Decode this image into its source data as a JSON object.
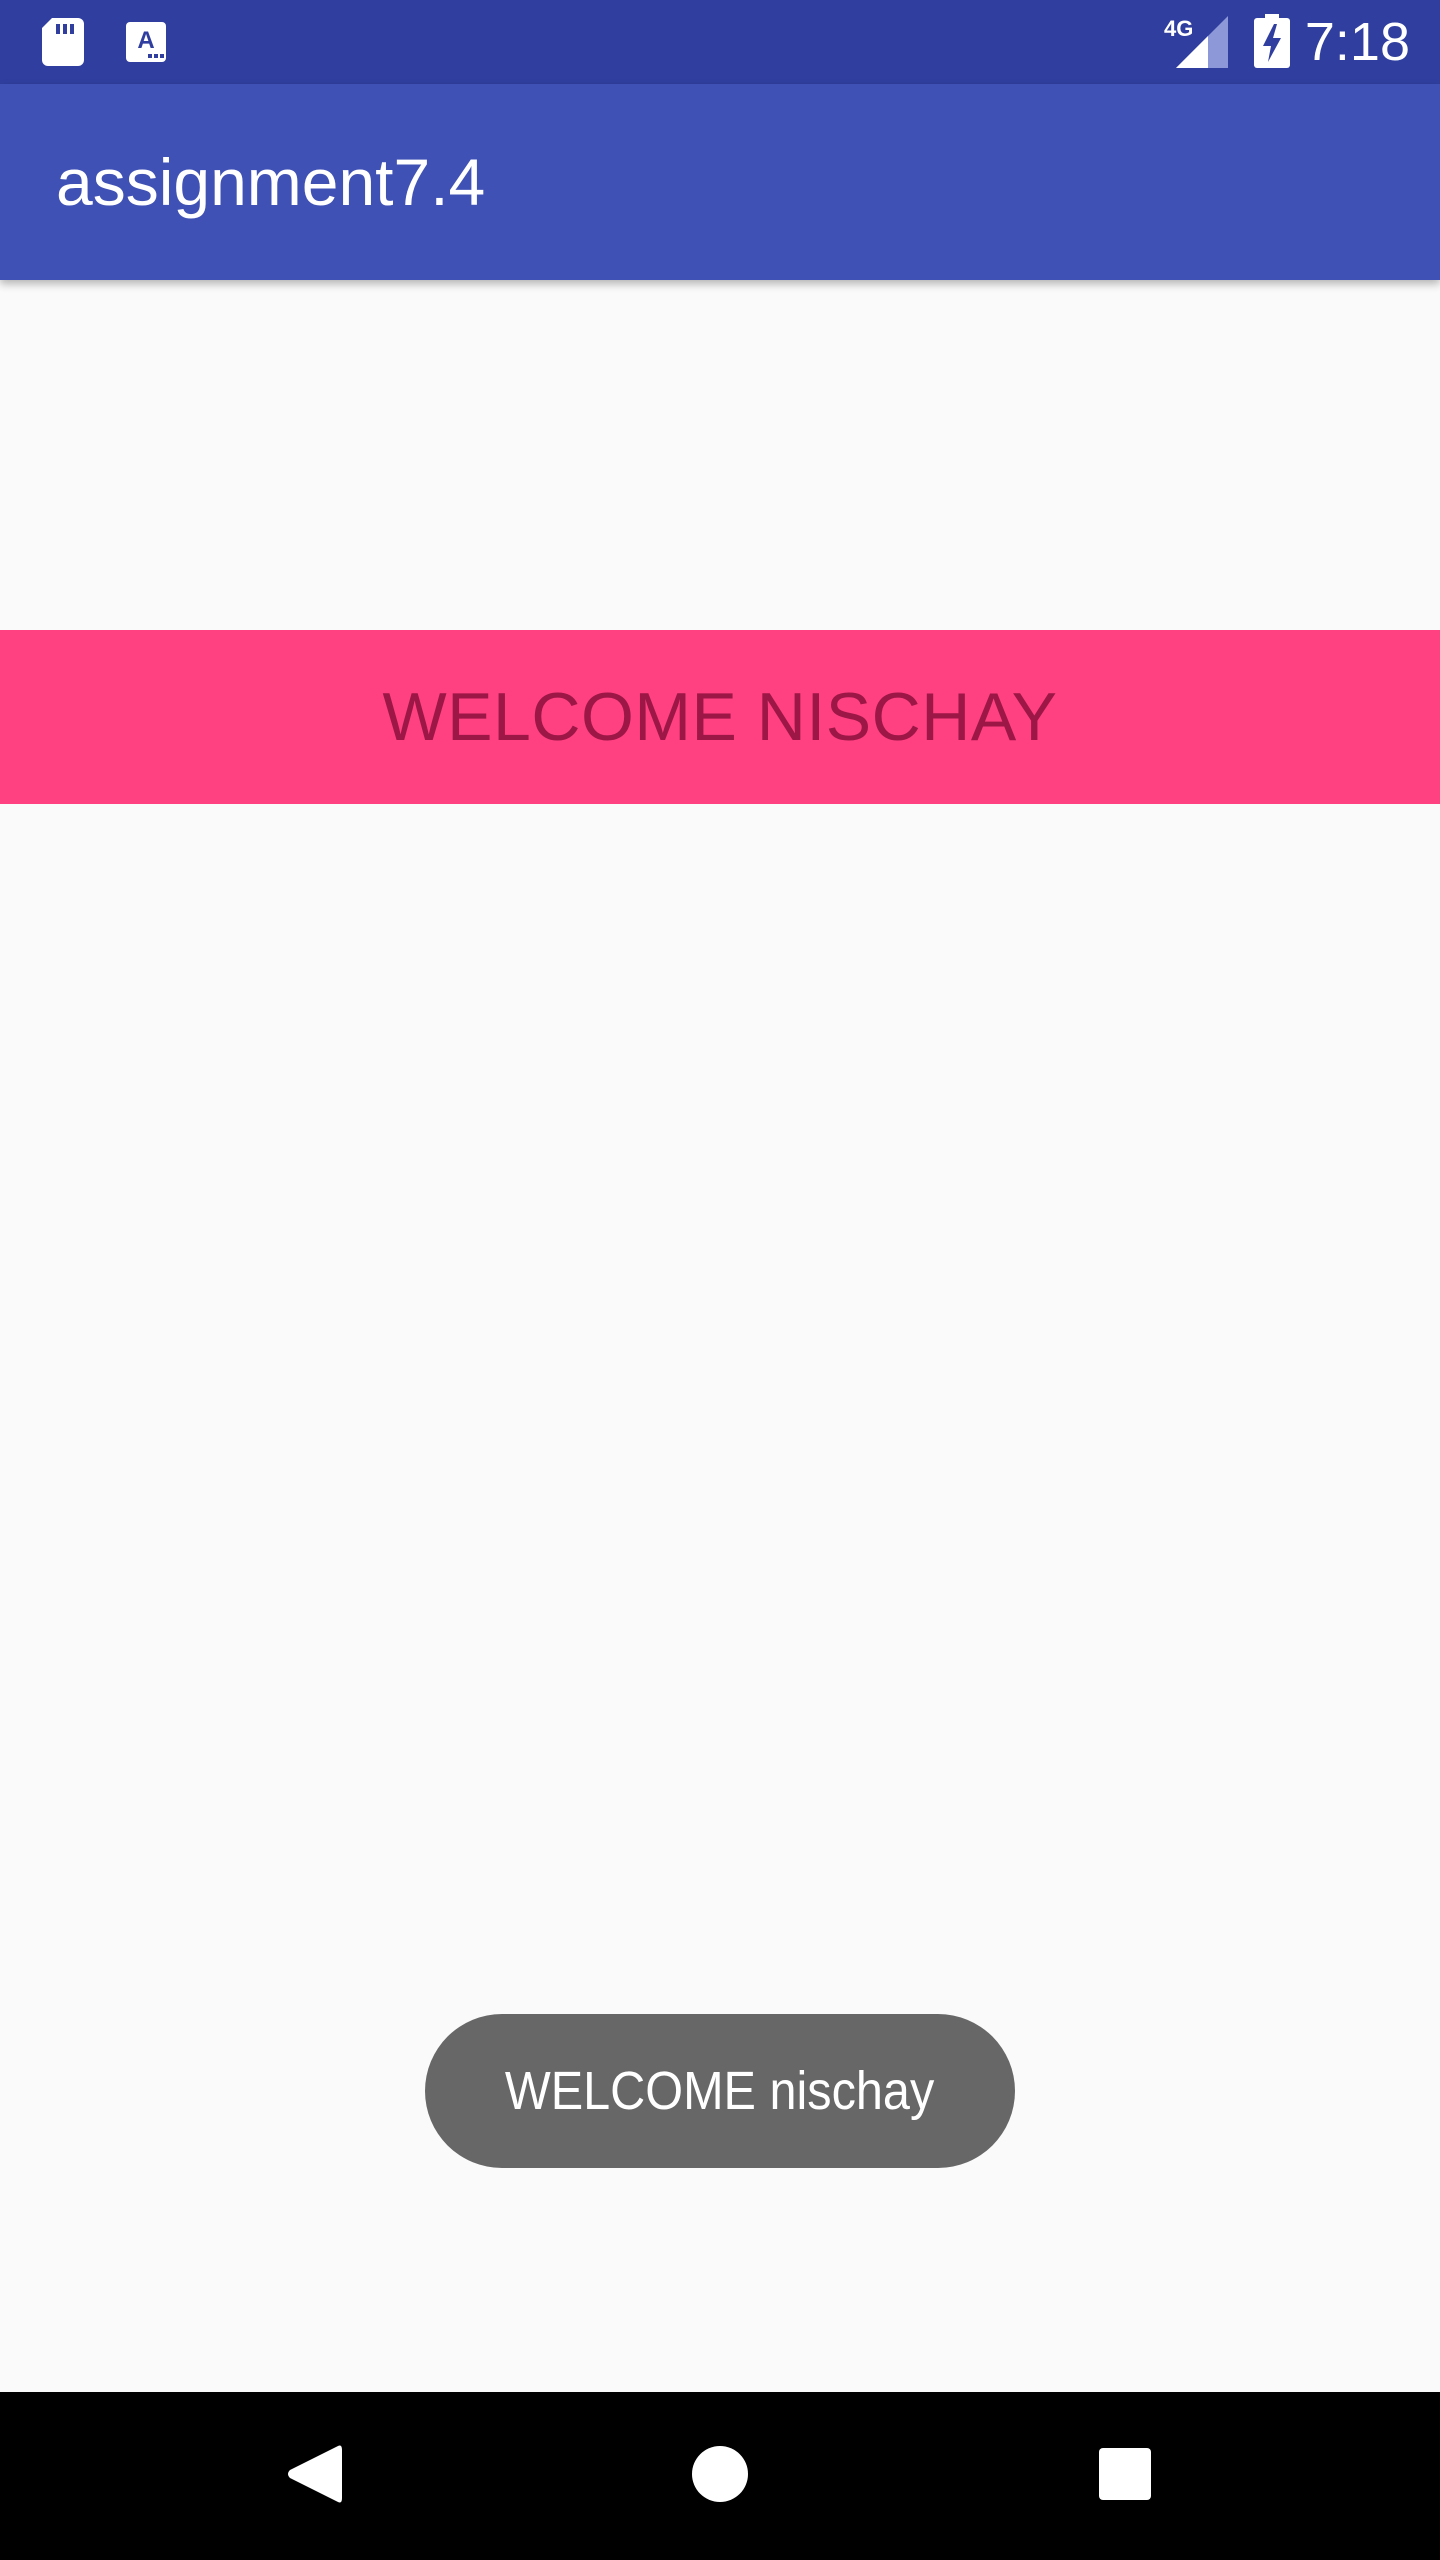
{
  "status_bar": {
    "network_type": "4G",
    "time": "7:18",
    "icons": [
      "sd-card-icon",
      "a-icon",
      "signal-icon",
      "battery-charging-icon"
    ]
  },
  "app_bar": {
    "title": "assignment7.4"
  },
  "banner": {
    "text": "WELCOME NISCHAY"
  },
  "toast": {
    "text": "WELCOME nischay"
  },
  "nav_bar": {
    "icons": [
      "back-icon",
      "home-icon",
      "recents-icon"
    ]
  },
  "colors": {
    "status_bar": "#303f9f",
    "app_bar": "#3f51b5",
    "banner_bg": "#ff4081",
    "banner_text": "#9c1646",
    "toast_bg": "#676767",
    "background": "#fafafa",
    "nav_bar": "#000000"
  }
}
